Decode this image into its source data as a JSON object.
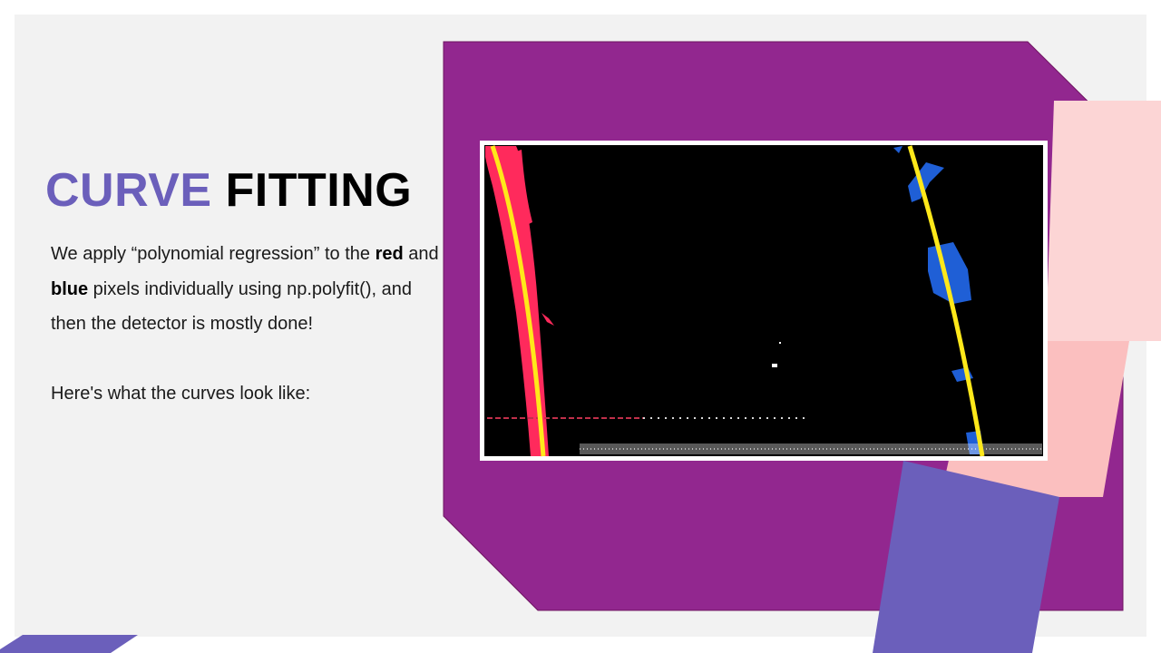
{
  "slide": {
    "title": {
      "word1": "CURVE",
      "word2": "FITTING"
    },
    "paragraph1": {
      "part1": "We apply “polynomial regression”  to the ",
      "bold1": "red",
      "part2": " and ",
      "bold2": "blue",
      "part3": " pixels individually using np.polyfit(), and then the detector is mostly done!"
    },
    "paragraph2": "Here's what the curves look like:"
  },
  "colors": {
    "title_accent": "#6b5fbb",
    "purple_panel": "#92278f",
    "lavender_bar": "#6b5fbb",
    "pink_light": "#fcd5d5",
    "pink_mid": "#fbbfbf",
    "lane_red": "#ff2a5c",
    "lane_blue": "#1f5fd6",
    "fit_line": "#ffe81a"
  }
}
